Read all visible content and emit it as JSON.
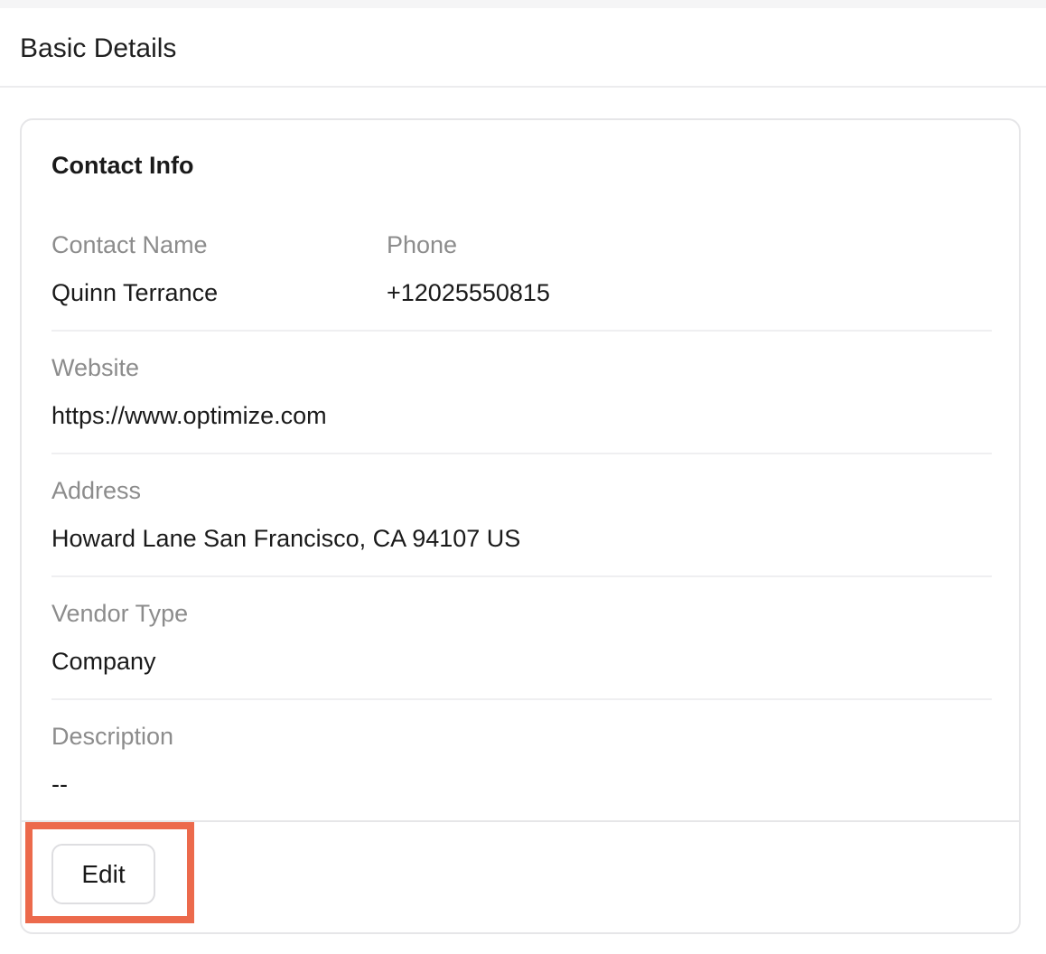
{
  "header": {
    "title": "Basic Details"
  },
  "card": {
    "title": "Contact Info",
    "fields": {
      "contact_name": {
        "label": "Contact Name",
        "value": "Quinn Terrance"
      },
      "phone": {
        "label": "Phone",
        "value": "+12025550815"
      },
      "website": {
        "label": "Website",
        "value": "https://www.optimize.com"
      },
      "address": {
        "label": "Address",
        "value": "Howard Lane San Francisco, CA 94107 US"
      },
      "vendor_type": {
        "label": "Vendor Type",
        "value": "Company"
      },
      "description": {
        "label": "Description",
        "value": "--"
      }
    },
    "edit_label": "Edit"
  },
  "colors": {
    "highlight": "#ec6a4c",
    "label_gray": "#8c8c8c",
    "text": "#1a1a1a"
  }
}
